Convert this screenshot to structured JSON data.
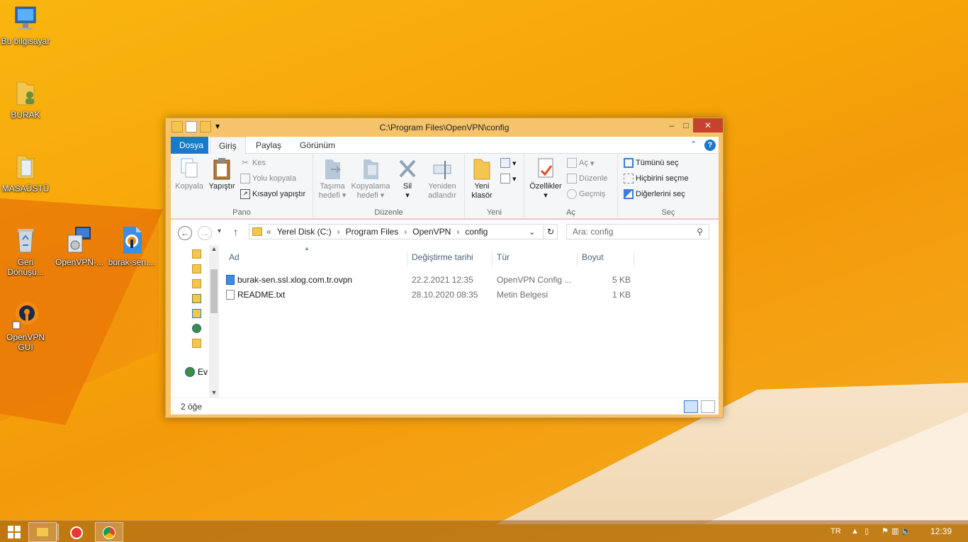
{
  "desktop": {
    "icons": [
      {
        "label": "Bu bilgisayar",
        "icon": "computer-icon"
      },
      {
        "label": "BURAK",
        "icon": "user-folder-icon"
      },
      {
        "label": "MASAÜSTÜ",
        "icon": "folder-icon"
      },
      {
        "label": "Geri Dönüşü...",
        "icon": "recycle-bin-icon"
      },
      {
        "label": "OpenVPN-...",
        "icon": "installer-icon"
      },
      {
        "label": "burak-sen....",
        "icon": "ovpn-file-icon"
      },
      {
        "label": "OpenVPN GUI",
        "icon": "openvpn-icon"
      }
    ]
  },
  "window": {
    "title": "C:\\Program Files\\OpenVPN\\config",
    "tabs": {
      "file": "Dosya",
      "home": "Giriş",
      "share": "Paylaş",
      "view": "Görünüm"
    },
    "ribbon": {
      "clipboard": {
        "label": "Pano",
        "copy": "Kopyala",
        "paste": "Yapıştır",
        "cut": "Kes",
        "copy_path": "Yolu kopyala",
        "paste_shortcut": "Kısayol yapıştır"
      },
      "organize": {
        "label": "Düzenle",
        "move_to_1": "Taşıma",
        "move_to_2": "hedefi",
        "copy_to_1": "Kopyalama",
        "copy_to_2": "hedefi",
        "delete": "Sil",
        "rename_1": "Yeniden",
        "rename_2": "adlandır"
      },
      "new": {
        "label": "Yeni",
        "new_folder_1": "Yeni",
        "new_folder_2": "klasör"
      },
      "open": {
        "label": "Aç",
        "properties": "Özellikler",
        "open": "Aç",
        "edit": "Düzenle",
        "history": "Geçmiş"
      },
      "select": {
        "label": "Seç",
        "select_all": "Tümünü seç",
        "select_none": "Hiçbirini seçme",
        "invert": "Diğerlerini seç"
      }
    },
    "address": {
      "prefix": "«",
      "crumbs": [
        "Yerel Disk (C:)",
        "Program Files",
        "OpenVPN",
        "config"
      ],
      "search_placeholder": "Ara: config"
    },
    "nav_partial_label": "Ev",
    "columns": {
      "name": "Ad",
      "date": "Değiştirme tarihi",
      "type": "Tür",
      "size": "Boyut"
    },
    "files": [
      {
        "name": "burak-sen.ssl.xlog.com.tr.ovpn",
        "date": "22.2.2021 12:35",
        "type": "OpenVPN Config ...",
        "size": "5 KB",
        "icon": "ovpn-file-icon"
      },
      {
        "name": "README.txt",
        "date": "28.10.2020 08:35",
        "type": "Metin Belgesi",
        "size": "1 KB",
        "icon": "text-file-icon"
      }
    ],
    "status": "2 öğe"
  },
  "taskbar": {
    "language": "TR",
    "clock": "12:39"
  },
  "colors": {
    "accent": "#1979ca",
    "close": "#c7412f",
    "window_frame": "#f5c46a"
  }
}
